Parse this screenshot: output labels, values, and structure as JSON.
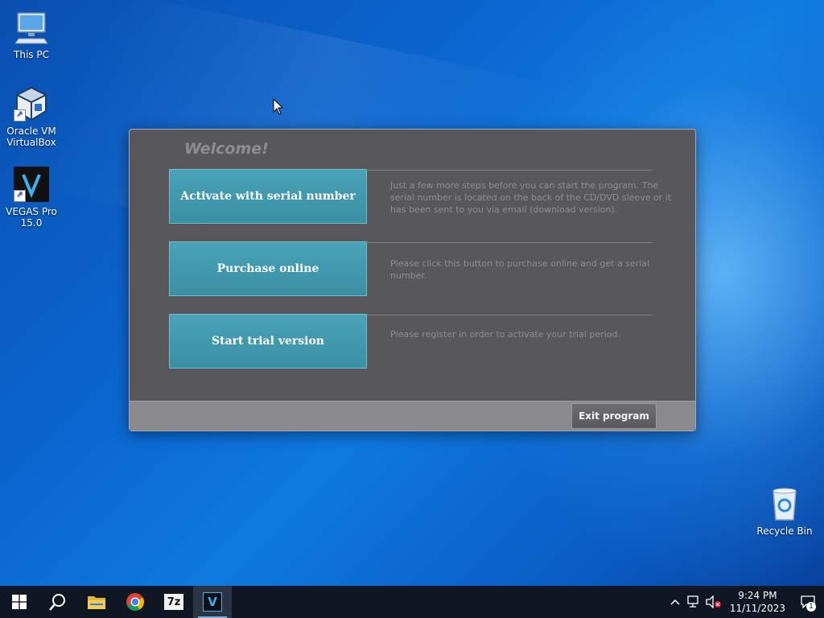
{
  "desktop": {
    "icons": [
      {
        "label": "This PC"
      },
      {
        "label": "Oracle VM VirtualBox"
      },
      {
        "label": "VEGAS Pro 15.0"
      },
      {
        "label": "Recycle Bin"
      }
    ]
  },
  "dialog": {
    "welcome": "Welcome!",
    "options": [
      {
        "button": "Activate with serial number",
        "description": "Just a few more steps before you can start the program. The serial number is located on the back of the CD/DVD sleeve or it has been sent to you via email (download version)."
      },
      {
        "button": "Purchase online",
        "description": "Please click this button to purchase online and get a serial number."
      },
      {
        "button": "Start trial version",
        "description": "Please register in order to activate your trial period."
      }
    ],
    "exit_label": "Exit program"
  },
  "taskbar": {
    "apps": [
      "start-icon",
      "search-icon",
      "file-explorer-icon",
      "chrome-icon",
      "7zip-icon",
      "vegas-icon"
    ],
    "sevenzip_text": "7z",
    "vegas_text": "V",
    "time": "9:24 PM",
    "date": "11/11/2023",
    "notification_count": "1"
  },
  "colors": {
    "accent_button": "#4aa3b7",
    "dialog_bg": "#58585c",
    "taskbar_bg": "#101724"
  }
}
